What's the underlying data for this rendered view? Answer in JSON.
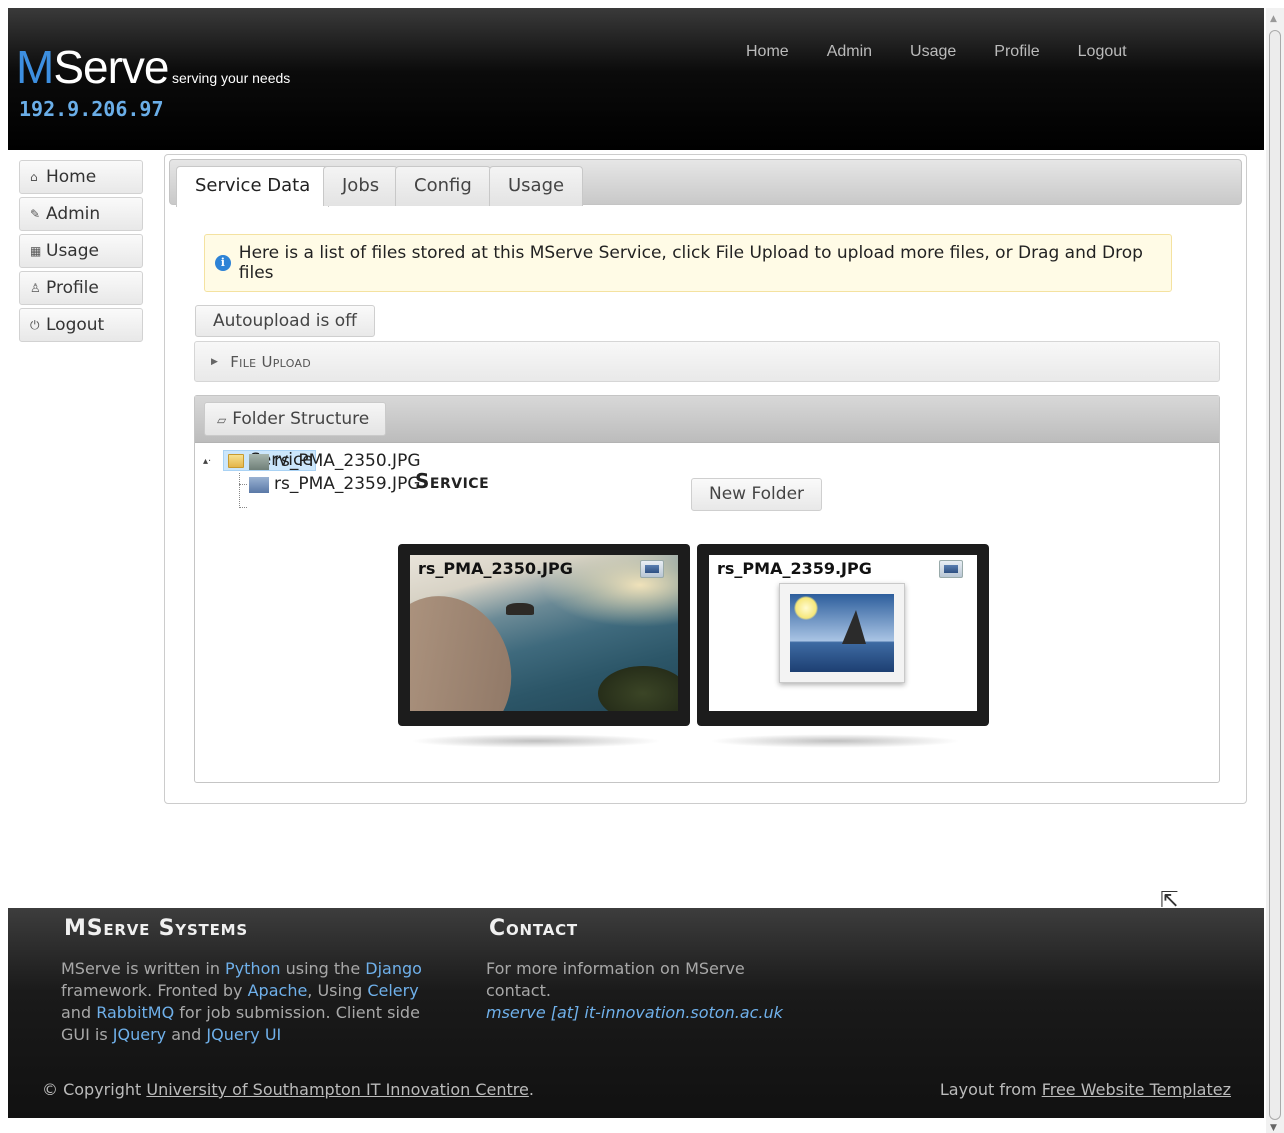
{
  "header": {
    "logo_m": "M",
    "logo_rest": "Serve",
    "tagline": "serving your needs",
    "ip": "192.9.206.97",
    "nav": [
      "Home",
      "Admin",
      "Usage",
      "Profile",
      "Logout"
    ]
  },
  "sidebar": {
    "items": [
      {
        "label": "Home",
        "icon": "home-icon"
      },
      {
        "label": "Admin",
        "icon": "wrench-icon"
      },
      {
        "label": "Usage",
        "icon": "calculator-icon"
      },
      {
        "label": "Profile",
        "icon": "person-icon"
      },
      {
        "label": "Logout",
        "icon": "power-icon"
      }
    ]
  },
  "tabs": [
    "Service Data",
    "Jobs",
    "Config",
    "Usage"
  ],
  "info_text": "Here is a list of files stored at this MServe Service, click File Upload to upload more files, or Drag and Drop files",
  "autoupload_label": "Autoupload is off",
  "file_upload_label": "File Upload",
  "folder_structure_label": "Folder Structure",
  "tree": {
    "root": "Service",
    "files": [
      "rs_PMA_2350.JPG",
      "rs_PMA_2359.JPG"
    ]
  },
  "service_title": "Service",
  "new_folder_label": "New Folder",
  "cards": [
    {
      "name": "rs_PMA_2350.JPG"
    },
    {
      "name": "rs_PMA_2359.JPG"
    }
  ],
  "footer": {
    "systems_title": "MServe Systems",
    "systems_text": {
      "p1": "MServe is written in ",
      "python": "Python",
      "p2": " using the ",
      "django": "Django",
      "p3": " framework. Fronted by ",
      "apache": "Apache",
      "p4": ", Using ",
      "celery": "Celery",
      "p5": " and ",
      "rabbitmq": "RabbitMQ",
      "p6": " for job submission. Client side GUI is ",
      "jquery": "JQuery",
      "p7": " and ",
      "jqueryui": "JQuery UI"
    },
    "contact_title": "Contact",
    "contact_text": "For more information on MServe contact.",
    "contact_email": "mserve [at] it-innovation.soton.ac.uk",
    "copyright_prefix": "© Copyright ",
    "copyright_link": "University of Southampton IT Innovation Centre",
    "copyright_suffix": ".",
    "layout_prefix": "Layout from ",
    "layout_link": "Free Website Templatez"
  }
}
